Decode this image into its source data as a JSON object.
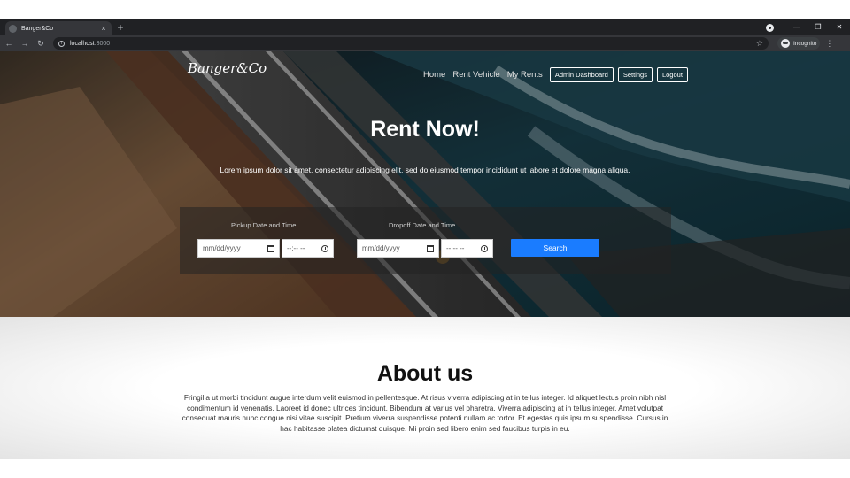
{
  "browser": {
    "tab_title": "Banger&Co",
    "tab_close": "×",
    "new_tab": "+",
    "url_host": "localhost",
    "url_port": ":3000",
    "profile_label": "Incognito",
    "window_controls": [
      "—",
      "❐",
      "✕"
    ],
    "nav_icons": [
      "back-icon",
      "forward-icon",
      "reload-icon"
    ]
  },
  "site": {
    "logo": "Banger&Co",
    "nav_links": [
      "Home",
      "Rent Vehicle",
      "My Rents"
    ],
    "nav_buttons": [
      "Admin Dashboard",
      "Settings",
      "Logout"
    ]
  },
  "hero": {
    "title": "Rent Now!",
    "subtitle": "Lorem ipsum dolor sit amet, consectetur adipiscing elit, sed do eiusmod tempor incididunt ut labore et dolore magna aliqua.",
    "pickup_label": "Pickup Date and Time",
    "dropoff_label": "Dropoff Date and Time",
    "date_placeholder": "mm/dd/yyyy",
    "time_placeholder": "--:-- --",
    "search_button": "Search"
  },
  "about": {
    "title": "About us",
    "body": "Fringilla ut morbi tincidunt augue interdum velit euismod in pellentesque. At risus viverra adipiscing at in tellus integer. Id aliquet lectus proin nibh nisl condimentum id venenatis. Laoreet id donec ultrices tincidunt. Bibendum at varius vel pharetra. Viverra adipiscing at in tellus integer. Amet volutpat consequat mauris nunc congue nisi vitae suscipit. Pretium viverra suspendisse potenti nullam ac tortor. Et egestas quis ipsum suspendisse. Cursus in hac habitasse platea dictumst quisque. Mi proin sed libero enim sed faucibus turpis in eu."
  },
  "colors": {
    "chrome_dark": "#202124",
    "chrome_toolbar": "#35363a",
    "accent_button": "#1a7cff",
    "about_bg": "#f4f4f4"
  }
}
